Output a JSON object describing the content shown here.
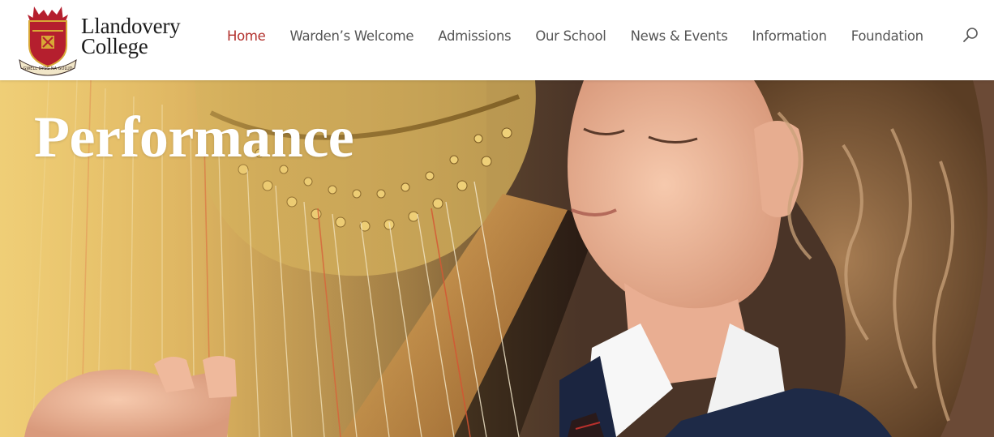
{
  "brand": {
    "name_line1": "Llandovery",
    "name_line2": "College",
    "motto": "GWELL DYSG NA GOLUD",
    "crest_colors": {
      "shield": "#b51f2e",
      "gold": "#d8a836",
      "dark": "#3a2a26"
    }
  },
  "nav": {
    "items": [
      {
        "label": "Home",
        "active": true
      },
      {
        "label": "Warden’s Welcome",
        "active": false
      },
      {
        "label": "Admissions",
        "active": false
      },
      {
        "label": "Our School",
        "active": false
      },
      {
        "label": "News & Events",
        "active": false
      },
      {
        "label": "Information",
        "active": false
      },
      {
        "label": "Foundation",
        "active": false
      }
    ],
    "search_icon": "search-icon"
  },
  "hero": {
    "title": "Performance",
    "image": "harp-player-photo"
  },
  "colors": {
    "accent": "#b2302c",
    "nav_text": "#555555",
    "hero_gold": "#e3bd63"
  }
}
